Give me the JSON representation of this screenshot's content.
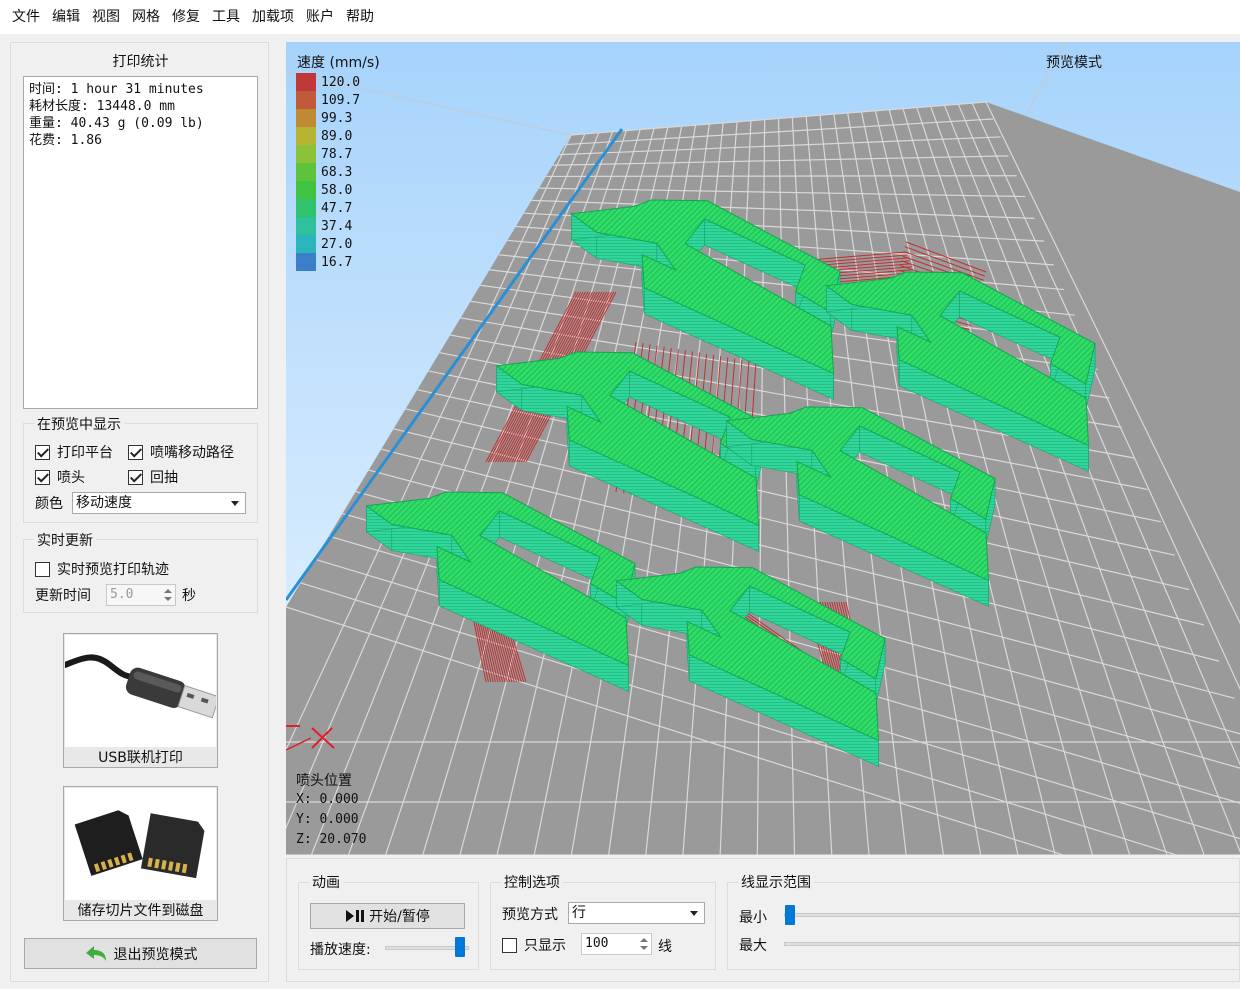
{
  "menu": [
    "文件",
    "编辑",
    "视图",
    "网格",
    "修复",
    "工具",
    "加载项",
    "账户",
    "帮助"
  ],
  "stats": {
    "title": "打印统计",
    "time": "时间: 1 hour 31 minutes",
    "filament": "耗材长度: 13448.0 mm",
    "weight": "重量: 40.43 g (0.09 lb)",
    "cost": "花费: 1.86"
  },
  "show_in_preview": {
    "title": "在预览中显示",
    "print_bed": "打印平台",
    "travel": "喷嘴移动路径",
    "nozzle": "喷头",
    "retract": "回抽",
    "color_label": "颜色",
    "color_value": "移动速度"
  },
  "realtime": {
    "title": "实时更新",
    "preview_label": "实时预览打印轨迹",
    "interval_label": "更新时间",
    "interval_value": "5.0",
    "unit": "秒"
  },
  "buttons": {
    "usb": "USB联机打印",
    "save": "储存切片文件到磁盘",
    "exit": "退出预览模式"
  },
  "viewport": {
    "mode": "预览模式",
    "legend_title": "速度 (mm/s)",
    "legend": [
      {
        "value": "120.0",
        "color": "#c0393a"
      },
      {
        "value": "109.7",
        "color": "#c05a3a"
      },
      {
        "value": "99.3",
        "color": "#c08a35"
      },
      {
        "value": "89.0",
        "color": "#b6b432"
      },
      {
        "value": "78.7",
        "color": "#8cc13a"
      },
      {
        "value": "68.3",
        "color": "#5fc23c"
      },
      {
        "value": "58.0",
        "color": "#3ec240"
      },
      {
        "value": "47.7",
        "color": "#2fc26a"
      },
      {
        "value": "37.4",
        "color": "#2dc29c"
      },
      {
        "value": "27.0",
        "color": "#2ab4bc"
      },
      {
        "value": "16.7",
        "color": "#3a7fc8"
      }
    ],
    "nozzle_title": "喷头位置",
    "x": "X: 0.000",
    "y": "Y: 0.000",
    "z": "Z: 20.070"
  },
  "animation": {
    "title": "动画",
    "play": "开始/暂停",
    "speed_label": "播放速度:",
    "speed_level": 0.95
  },
  "control": {
    "title": "控制选项",
    "mode_label": "预览方式",
    "mode_value": "行",
    "only_show": "只显示",
    "count": "100",
    "unit": "线"
  },
  "range": {
    "title": "线显示范围",
    "min": "最小",
    "max": "最大"
  }
}
